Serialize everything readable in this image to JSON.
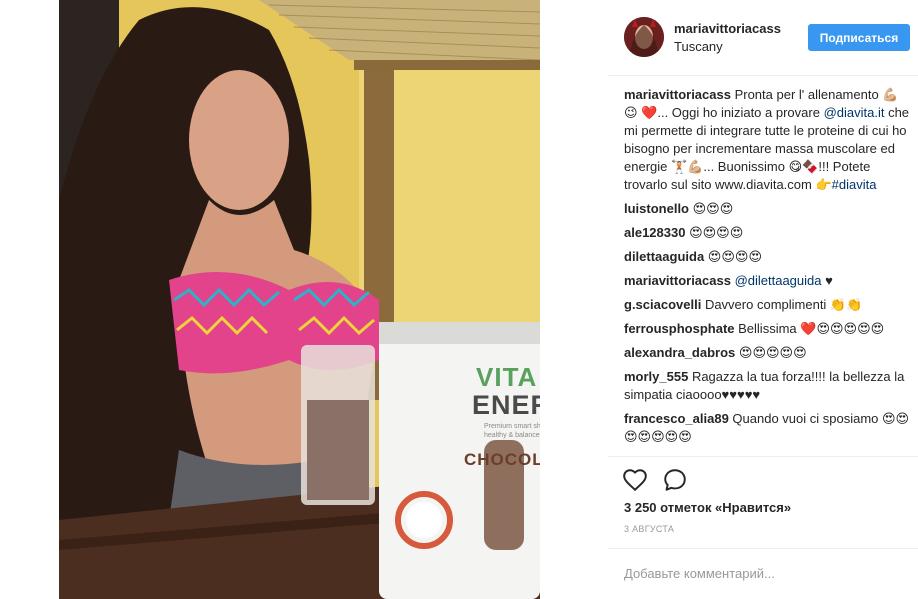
{
  "photo": {
    "product": {
      "brand_line1": "VITA",
      "brand_line2": "ENERGY",
      "tagline": "Premium smart shake for healthy & balanced life",
      "flavor": "CHOCOLATE"
    }
  },
  "header": {
    "username": "mariavittoriacass",
    "location": "Tuscany",
    "follow_label": "Подписаться"
  },
  "caption": {
    "username": "mariavittoriacass",
    "text_1": " Pronta per l' allenamento 💪🏼😉 ❤️... Oggi ho iniziato a provare ",
    "mention": "@diavita.it",
    "text_2": " che mi permette di integrare tutte le proteine di cui ho bisogno per incrementare massa muscolare ed energie 🏋🏻💪🏼... Buonissimo 😋🍫!!! Potete trovarlo sul sito www.diavita.com 👉",
    "hashtag": "#diavita"
  },
  "comments": [
    {
      "username": "luistonello",
      "text": " 😍😍😍"
    },
    {
      "username": "ale128330",
      "text": " 😍😍😍😍"
    },
    {
      "username": "dilettaaguida",
      "text": " 😍😍😍😍"
    },
    {
      "username": "mariavittoriacass",
      "mention": " @dilettaaguida",
      "text": " ♥"
    },
    {
      "username": "g.sciacovelli",
      "text": " Davvero complimenti 👏👏"
    },
    {
      "username": "ferrousphosphate",
      "text": " Bellissima ❤️😍😍😍😍😍"
    },
    {
      "username": "alexandra_dabros",
      "text": " 😍😍😍😍😍"
    },
    {
      "username": "morly_555",
      "text": " Ragazza la tua forza!!!! la bellezza la simpatia ciaoooo♥♥♥♥♥"
    },
    {
      "username": "francesco_alia89",
      "text": " Quando vuoi ci sposiamo 😍😍😍😍😍😍😍"
    }
  ],
  "likes": "3 250 отметок «Нравится»",
  "date": "3 августа",
  "add_comment_placeholder": "Добавьте комментарий...",
  "icons": {
    "like": "heart-icon",
    "comment": "comment-icon"
  },
  "colors": {
    "accent": "#3897f0",
    "mention": "#003569",
    "muted": "#999999"
  }
}
